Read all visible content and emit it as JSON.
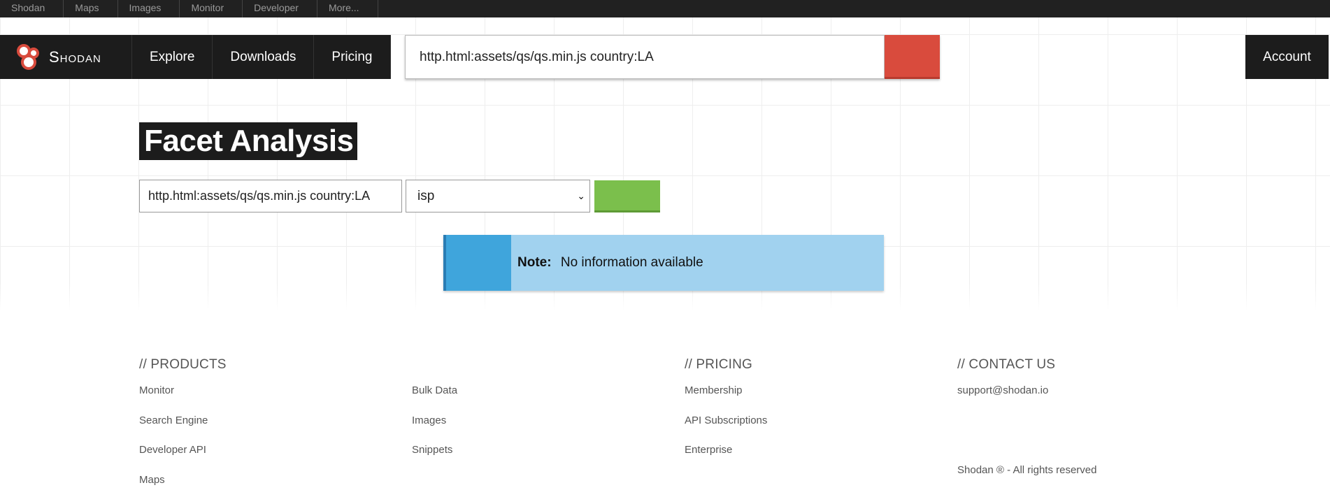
{
  "topbar": {
    "items": [
      "Shodan",
      "Maps",
      "Images",
      "Monitor",
      "Developer",
      "More..."
    ]
  },
  "header": {
    "logo_text": "Shodan",
    "nav": [
      "Explore",
      "Downloads",
      "Pricing"
    ],
    "search": {
      "value": "http.html:assets/qs/qs.min.js country:LA"
    },
    "account_label": "Account"
  },
  "main": {
    "title": "Facet Analysis",
    "query_value": "http.html:assets/qs/qs.min.js country:LA",
    "facet_selected": "isp",
    "note_label": "Note:",
    "note_text": "No information available"
  },
  "footer": {
    "products_heading": "// PRODUCTS",
    "products_col1": [
      "Monitor",
      "Search Engine",
      "Developer API",
      "Maps"
    ],
    "products_col2": [
      "Bulk Data",
      "Images",
      "Snippets"
    ],
    "pricing_heading": "// PRICING",
    "pricing_links": [
      "Membership",
      "API Subscriptions",
      "Enterprise"
    ],
    "contact_heading": "// CONTACT US",
    "contact_email": "support@shodan.io",
    "copyright": "Shodan ® - All rights reserved"
  },
  "colors": {
    "header_bg": "#1c1c1c",
    "search_button": "#d94b3d",
    "submit_button": "#7bbf4c",
    "note_bg": "#a1d2ef",
    "note_accent": "#3fa5dc"
  }
}
